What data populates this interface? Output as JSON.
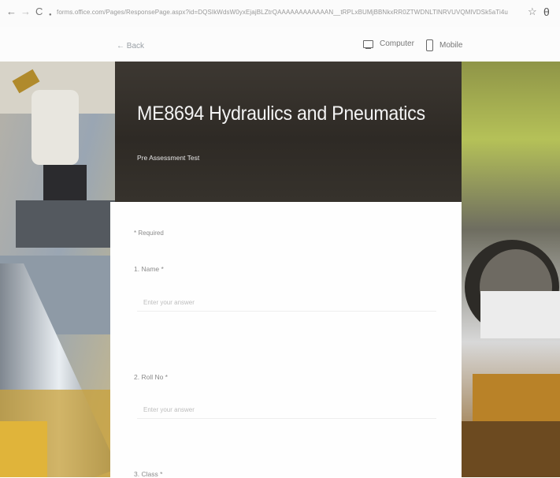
{
  "browser": {
    "url": "forms.office.com/Pages/ResponsePage.aspx?id=DQSIkWdsW0yxEjajBLZtrQAAAAAAAAAAAAN__tRPLxBUMjBBNkxRR0ZTWDNLTlNRVUVQMlVDSk5aTi4u",
    "back_glyph": "←",
    "forward_glyph": "→",
    "reload_glyph": "C",
    "lock_glyph": "●",
    "star_glyph": "☆",
    "account_glyph": "θ"
  },
  "toolbar": {
    "back_label": "← Back",
    "computer_label": "Computer",
    "mobile_label": "Mobile"
  },
  "form": {
    "title": "ME8694 Hydraulics and Pneumatics",
    "subtitle": "Pre Assessment Test",
    "required_note": "* Required",
    "questions": [
      {
        "label": "1. Name *",
        "placeholder": "Enter your answer"
      },
      {
        "label": "2. Roll No *",
        "placeholder": "Enter your answer"
      },
      {
        "label": "3. Class *"
      }
    ]
  },
  "icons": {
    "computer": "monitor-icon",
    "mobile": "phone-icon"
  }
}
